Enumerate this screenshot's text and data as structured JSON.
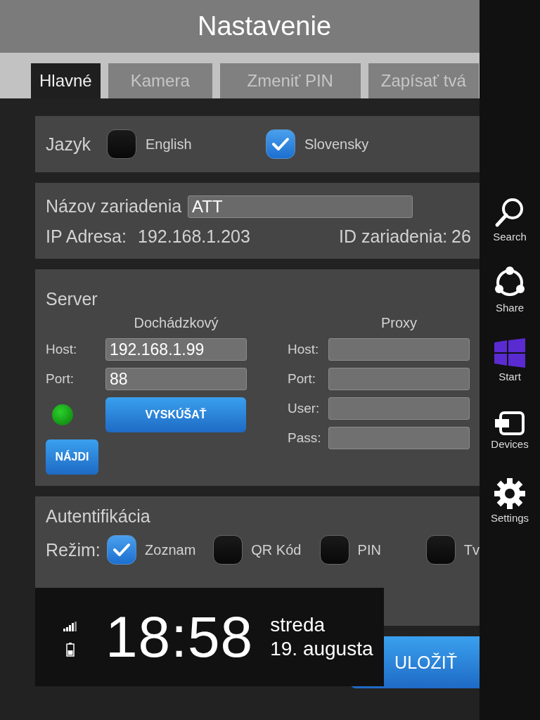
{
  "title": "Nastavenie",
  "tabs": [
    {
      "label": "Hlavné",
      "selected": true
    },
    {
      "label": "Kamera",
      "selected": false
    },
    {
      "label": "Zmeniť PIN",
      "selected": false
    },
    {
      "label": "Zapísať tvá",
      "selected": false
    }
  ],
  "language": {
    "label": "Jazyk",
    "options": [
      {
        "label": "English",
        "checked": false
      },
      {
        "label": "Slovensky",
        "checked": true
      }
    ]
  },
  "device": {
    "name_label": "Názov zariadenia",
    "name_value": "ATT",
    "ip_label": "IP Adresa:",
    "ip_value": "192.168.1.203",
    "id_label": "ID zariadenia:",
    "id_value": "26"
  },
  "server": {
    "title": "Server",
    "attendance": {
      "title": "Dochádzkový",
      "fields": [
        {
          "label": "Host:",
          "value": "192.168.1.99"
        },
        {
          "label": "Port:",
          "value": "88"
        }
      ],
      "connected": true,
      "test_button": "VYSKÚŠAŤ",
      "find_button": "NÁJDI"
    },
    "proxy": {
      "title": "Proxy",
      "fields": [
        {
          "label": "Host:"
        },
        {
          "label": "Port:"
        },
        {
          "label": "User:"
        },
        {
          "label": "Pass:"
        }
      ]
    }
  },
  "authentication": {
    "title": "Autentifikácia",
    "mode_label": "Režim:",
    "modes": [
      {
        "label": "Zoznam",
        "checked": true
      },
      {
        "label": "QR Kód",
        "checked": false
      },
      {
        "label": "PIN",
        "checked": false
      },
      {
        "label": "Tv",
        "checked": false
      }
    ]
  },
  "save_button": "ULOŽIŤ",
  "lock_overlay": {
    "time": "18:58",
    "day": "streda",
    "date": "19. augusta"
  },
  "charms": [
    {
      "label": "Search",
      "kind": "search"
    },
    {
      "label": "Share",
      "kind": "share"
    },
    {
      "label": "Start",
      "kind": "start"
    },
    {
      "label": "Devices",
      "kind": "devices"
    },
    {
      "label": "Settings",
      "kind": "settings"
    }
  ]
}
